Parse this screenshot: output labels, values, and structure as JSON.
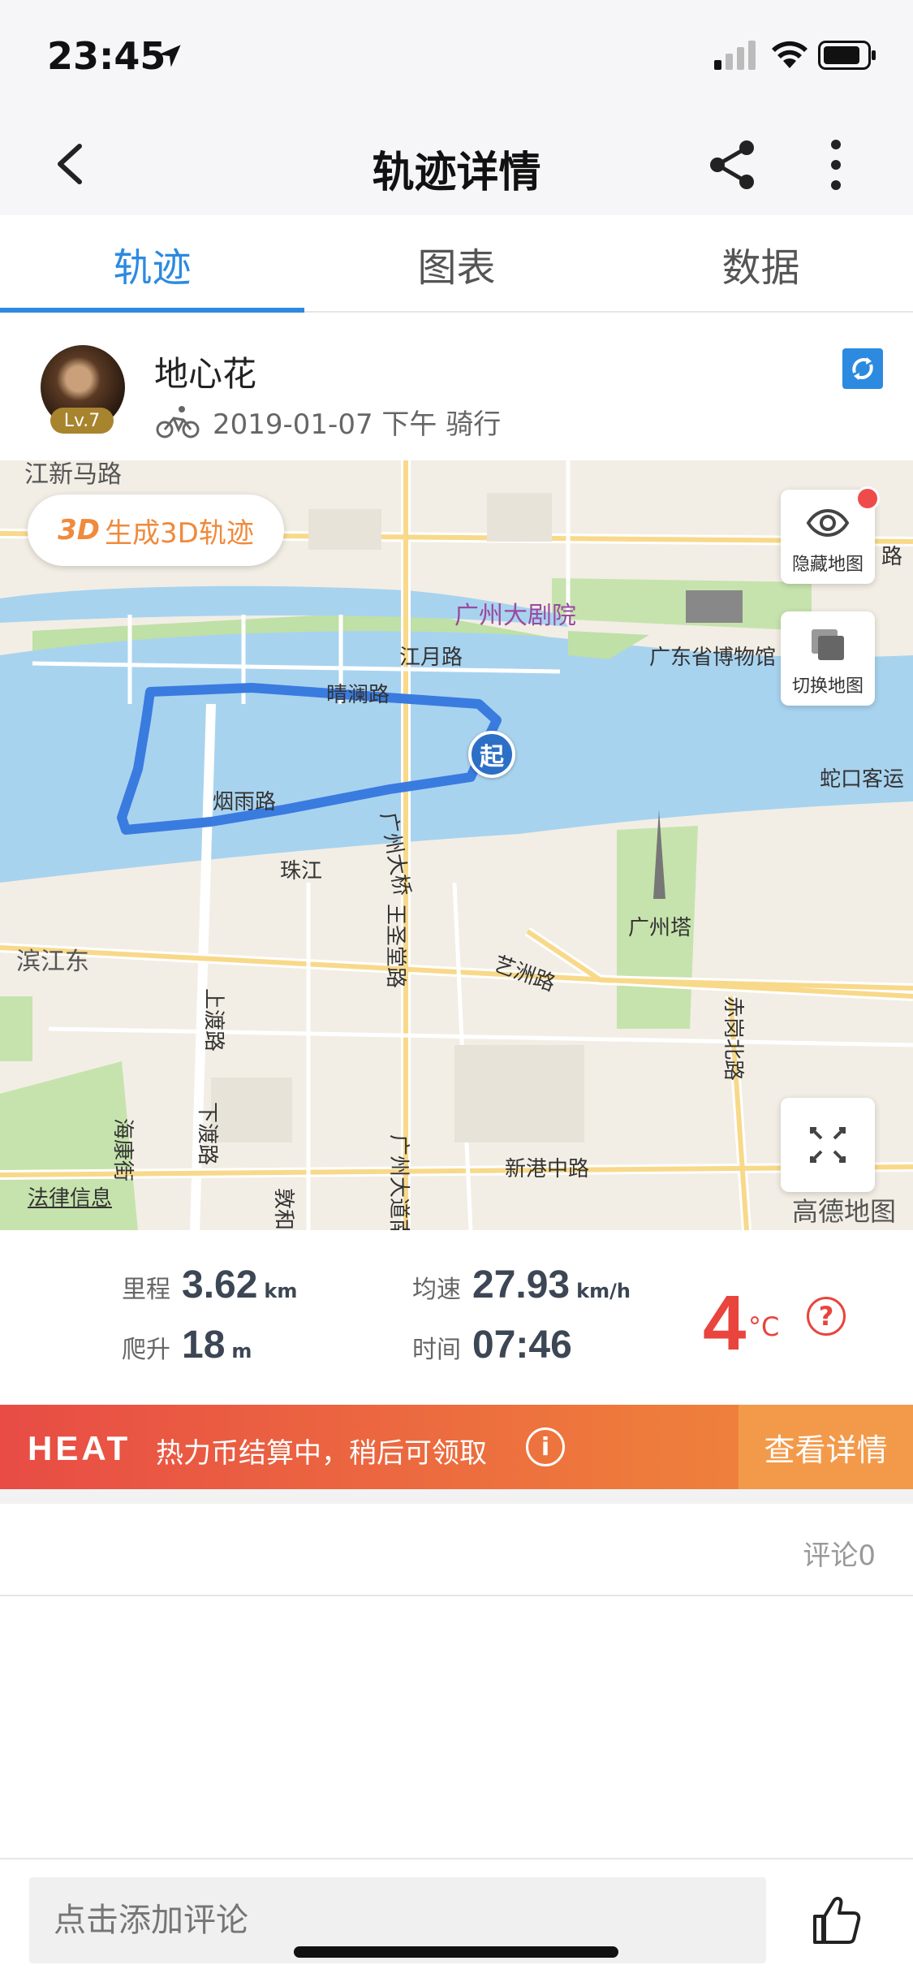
{
  "status_bar": {
    "time": "23:45"
  },
  "nav": {
    "title": "轨迹详情"
  },
  "tabs": [
    {
      "label": "轨迹",
      "active": true
    },
    {
      "label": "图表",
      "active": false
    },
    {
      "label": "数据",
      "active": false
    }
  ],
  "user": {
    "name": "地心花",
    "level": "Lv.7",
    "meta": "2019-01-07 下午   骑行"
  },
  "map": {
    "btn_3d_badge": "3D",
    "btn_3d_label": "生成3D轨迹",
    "hide_map_label": "隐藏地图",
    "switch_map_label": "切换地图",
    "start_marker": "起",
    "legal": "法律信息",
    "provider": "高德地图",
    "labels": {
      "road1": "江月路",
      "road2": "晴澜路",
      "road3": "烟雨路",
      "river": "珠江",
      "bridge": "广州大桥",
      "opera": "广州大剧院",
      "museum": "广东省博物馆",
      "tower": "广州塔",
      "binjiang": "滨江东",
      "yizhou": "艺洲路",
      "xingang": "新港中路",
      "shekou": "蛇口客运",
      "chigang": "赤岗北路",
      "shangdu": "上渡路",
      "xiadu": "下渡路",
      "haikang": "海康街",
      "wangting": "王圣堂路",
      "guangzhou_ave": "广州大道南",
      "dunhe": "敦和",
      "lu": "路",
      "topleft": "江新马路"
    }
  },
  "stats": {
    "distance_label": "里程",
    "distance": "3.62",
    "distance_unit": "km",
    "speed_label": "均速",
    "speed": "27.93",
    "speed_unit": "km/h",
    "climb_label": "爬升",
    "climb": "18",
    "climb_unit": "m",
    "time_label": "时间",
    "time": "07:46",
    "temperature": "4",
    "temp_unit": "°C",
    "help": "?"
  },
  "heat": {
    "logo": "HEAT",
    "message": "热力币结算中，稍后可领取",
    "info": "i",
    "button": "查看详情"
  },
  "comments": {
    "count_label": "评论0"
  },
  "bottom": {
    "placeholder": "点击添加评论"
  },
  "colors": {
    "accent": "#2c8ae0",
    "route": "#3a7be0",
    "water": "#a8d3ef",
    "heat_start": "#e84c45",
    "heat_end": "#f08a3c",
    "temperature": "#e9443d"
  }
}
